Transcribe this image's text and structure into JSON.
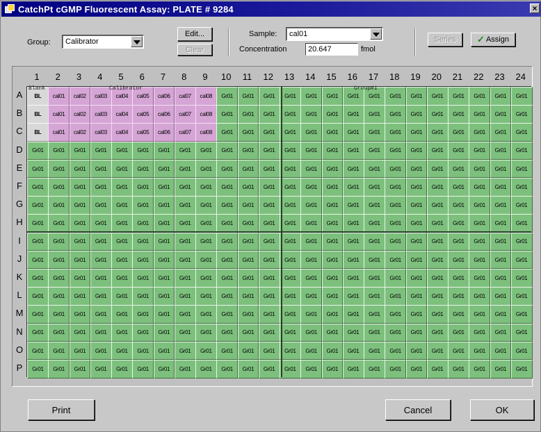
{
  "window": {
    "title": "CatchPt cGMP Fluorescent Assay: PLATE # 9284",
    "close_glyph": "×"
  },
  "toolbar": {
    "group_label": "Group:",
    "group_value": "Calibrator",
    "edit_label": "Edit...",
    "clear_label": "Clear",
    "sample_label": "Sample:",
    "sample_value": "cal01",
    "concentration_label": "Concentration",
    "concentration_value": "20.647",
    "unit_label": "fmol",
    "series_label": "Series",
    "assign_label": "Assign"
  },
  "plate": {
    "columns": [
      "1",
      "2",
      "3",
      "4",
      "5",
      "6",
      "7",
      "8",
      "9",
      "10",
      "11",
      "12",
      "13",
      "14",
      "15",
      "16",
      "17",
      "18",
      "19",
      "20",
      "21",
      "22",
      "23",
      "24"
    ],
    "rows": [
      "A",
      "B",
      "C",
      "D",
      "E",
      "F",
      "G",
      "H",
      "I",
      "J",
      "K",
      "L",
      "M",
      "N",
      "O",
      "P"
    ],
    "group_labels": {
      "blank": "Blank",
      "calibrator": "Calibrator",
      "group": "Group#1"
    },
    "blank_cell": "BL",
    "calibrator_cells": [
      "cal01",
      "cal02",
      "cal03",
      "cal04",
      "cal05",
      "cal06",
      "cal07",
      "cal08"
    ],
    "group_cell": "Gr01",
    "colors": {
      "group": "#7dc07d",
      "calibrator": "#d5a5d5",
      "blank": "#d8d8d8"
    }
  },
  "footer": {
    "print_label": "Print",
    "cancel_label": "Cancel",
    "ok_label": "OK"
  }
}
